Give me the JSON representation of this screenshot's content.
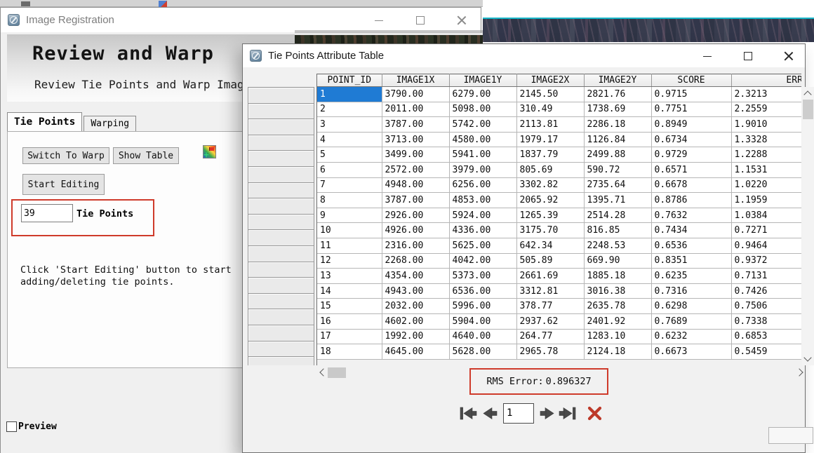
{
  "registration_window": {
    "title": "Image Registration",
    "header": {
      "title": "Review and Warp",
      "subtitle": "Review Tie Points and Warp Image"
    },
    "tabs": [
      {
        "label": "Tie Points"
      },
      {
        "label": "Warping"
      }
    ],
    "active_tab": "Tie Points",
    "buttons": {
      "switch_to_warp": "Switch To Warp",
      "show_table": "Show Table",
      "start_editing": "Start Editing"
    },
    "tie_points": {
      "count": "39",
      "label": "Tie Points"
    },
    "instruction": {
      "line1": "Click 'Start Editing' button to start",
      "line2": "adding/deleting tie points."
    },
    "preview": {
      "label": "Preview",
      "checked": false
    }
  },
  "table_window": {
    "title": "Tie Points Attribute Table",
    "columns": [
      "POINT_ID",
      "IMAGE1X",
      "IMAGE1Y",
      "IMAGE2X",
      "IMAGE2Y",
      "SCORE",
      "ERROR"
    ],
    "rows": [
      [
        "1",
        "3790.00",
        "6279.00",
        "2145.50",
        "2821.76",
        "0.9715",
        "2.3213"
      ],
      [
        "2",
        "2011.00",
        "5098.00",
        "310.49",
        "1738.69",
        "0.7751",
        "2.2559"
      ],
      [
        "3",
        "3787.00",
        "5742.00",
        "2113.81",
        "2286.18",
        "0.8949",
        "1.9010"
      ],
      [
        "4",
        "3713.00",
        "4580.00",
        "1979.17",
        "1126.84",
        "0.6734",
        "1.3328"
      ],
      [
        "5",
        "3499.00",
        "5941.00",
        "1837.79",
        "2499.88",
        "0.9729",
        "1.2288"
      ],
      [
        "6",
        "2572.00",
        "3979.00",
        "805.69",
        "590.72",
        "0.6571",
        "1.1531"
      ],
      [
        "7",
        "4948.00",
        "6256.00",
        "3302.82",
        "2735.64",
        "0.6678",
        "1.0220"
      ],
      [
        "8",
        "3787.00",
        "4853.00",
        "2065.92",
        "1395.71",
        "0.8786",
        "1.1959"
      ],
      [
        "9",
        "2926.00",
        "5924.00",
        "1265.39",
        "2514.28",
        "0.7632",
        "1.0384"
      ],
      [
        "10",
        "4926.00",
        "4336.00",
        "3175.70",
        "816.85",
        "0.7434",
        "0.7271"
      ],
      [
        "11",
        "2316.00",
        "5625.00",
        "642.34",
        "2248.53",
        "0.6536",
        "0.9464"
      ],
      [
        "12",
        "2268.00",
        "4042.00",
        "505.89",
        "669.90",
        "0.8351",
        "0.9372"
      ],
      [
        "13",
        "4354.00",
        "5373.00",
        "2661.69",
        "1885.18",
        "0.6235",
        "0.7131"
      ],
      [
        "14",
        "4943.00",
        "6536.00",
        "3312.81",
        "3016.38",
        "0.7316",
        "0.7426"
      ],
      [
        "15",
        "2032.00",
        "5996.00",
        "378.77",
        "2635.78",
        "0.6298",
        "0.7506"
      ],
      [
        "16",
        "4602.00",
        "5904.00",
        "2937.62",
        "2401.92",
        "0.7689",
        "0.7338"
      ],
      [
        "17",
        "1992.00",
        "4640.00",
        "264.77",
        "1283.10",
        "0.6232",
        "0.6853"
      ],
      [
        "18",
        "4645.00",
        "5628.00",
        "2965.78",
        "2124.18",
        "0.6673",
        "0.5459"
      ]
    ],
    "selected_cell": {
      "row": "1",
      "column": "POINT_ID"
    },
    "rms": {
      "label": "RMS Error:",
      "value": "0.896327"
    },
    "record_navigator": {
      "current": "1"
    }
  },
  "colors": {
    "selection_blue": "#1f7bd4",
    "annotation_red": "#cf3b2b",
    "accent_teal": "#17b6c8"
  }
}
